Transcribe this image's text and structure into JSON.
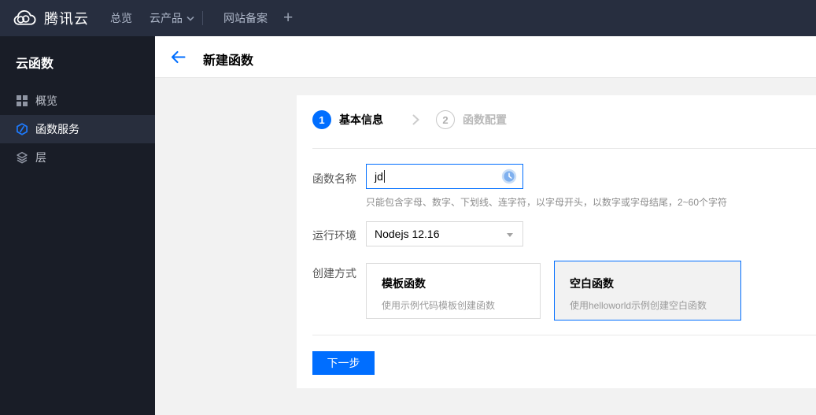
{
  "colors": {
    "accent": "#006eff",
    "navbar_bg": "#272e3f",
    "sidebar_bg": "#191d27",
    "content_bg": "#f2f2f2"
  },
  "navbar": {
    "brand": "腾讯云",
    "overview": "总览",
    "products": "云产品",
    "icp": "网站备案",
    "add_tab": "+"
  },
  "sidebar": {
    "title": "云函数",
    "items": [
      {
        "label": "概览",
        "icon": "grid-icon",
        "active": false
      },
      {
        "label": "函数服务",
        "icon": "function-hexagon-icon",
        "active": true
      },
      {
        "label": "层",
        "icon": "layers-icon",
        "active": false
      }
    ]
  },
  "page_header": {
    "title": "新建函数",
    "back_icon": "arrow-left-icon"
  },
  "wizard": {
    "steps": [
      {
        "number": "1",
        "label": "基本信息",
        "state": "active"
      },
      {
        "number": "2",
        "label": "函数配置",
        "state": "pending"
      }
    ]
  },
  "form": {
    "name_field": {
      "label": "函数名称",
      "value": "jd",
      "helper": "只能包含字母、数字、下划线、连字符，以字母开头，以数字或字母结尾，2~60个字符",
      "status_icon": "clock-pending-icon"
    },
    "runtime_field": {
      "label": "运行环境",
      "value": "Nodejs 12.16"
    },
    "create_method": {
      "label": "创建方式",
      "options": [
        {
          "title": "模板函数",
          "desc": "使用示例代码模板创建函数",
          "selected": false
        },
        {
          "title": "空白函数",
          "desc": "使用helloworld示例创建空白函数",
          "selected": true
        }
      ]
    },
    "next_button": "下一步"
  }
}
